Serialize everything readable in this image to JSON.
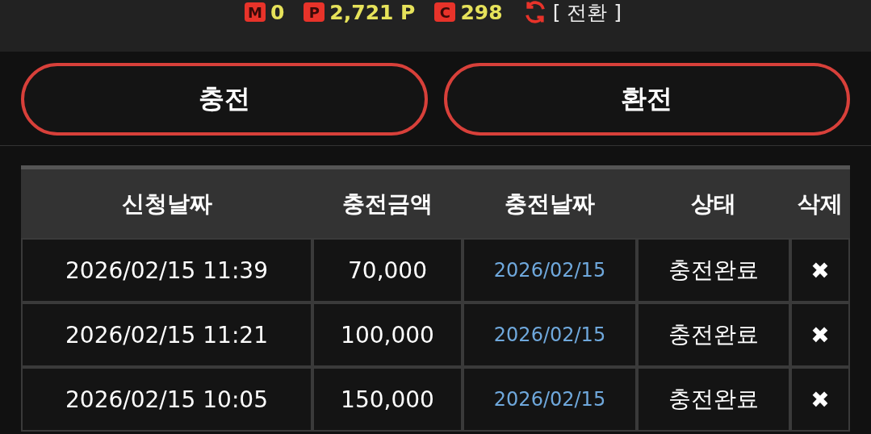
{
  "balances": [
    {
      "badge": "M",
      "amount": "0"
    },
    {
      "badge": "P",
      "amount": "2,721 P"
    },
    {
      "badge": "C",
      "amount": "298"
    }
  ],
  "convert_link": "[ 전환 ]",
  "buttons": [
    "충전",
    "환전"
  ],
  "table": {
    "columns": [
      "신청날짜",
      "충전금액",
      "충전날짜",
      "상태",
      "삭제"
    ],
    "rows": [
      {
        "requested": "2026/02/15 11:39",
        "amount": "70,000",
        "charged": "2026/02/15",
        "status": "충전완료",
        "delete": "✖"
      },
      {
        "requested": "2026/02/15 11:21",
        "amount": "100,000",
        "charged": "2026/02/15",
        "status": "충전완료",
        "delete": "✖"
      },
      {
        "requested": "2026/02/15 10:05",
        "amount": "150,000",
        "charged": "2026/02/15",
        "status": "충전완료",
        "delete": "✖"
      }
    ]
  }
}
